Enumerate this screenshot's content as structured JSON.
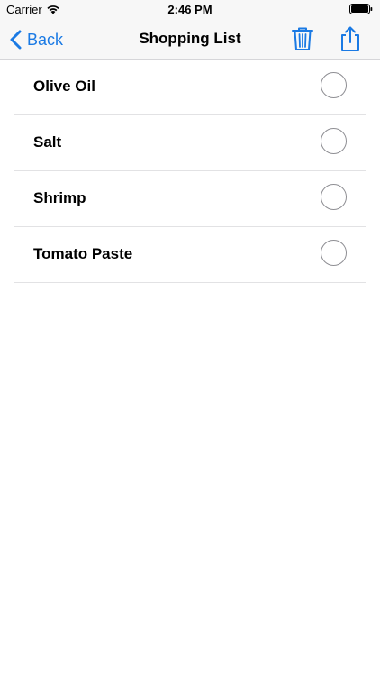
{
  "status_bar": {
    "carrier": "Carrier",
    "time": "2:46 PM"
  },
  "nav": {
    "back_label": "Back",
    "title": "Shopping List",
    "icons": [
      "chevron-left-icon",
      "trash-icon",
      "share-icon"
    ]
  },
  "list": {
    "items": [
      {
        "label": "Olive Oil",
        "checked": false
      },
      {
        "label": "Salt",
        "checked": false
      },
      {
        "label": "Shrimp",
        "checked": false
      },
      {
        "label": "Tomato Paste",
        "checked": false
      }
    ]
  },
  "colors": {
    "accent": "#1a7ae4",
    "bar_background": "#f7f7f7",
    "separator": "#e2e2e4"
  }
}
